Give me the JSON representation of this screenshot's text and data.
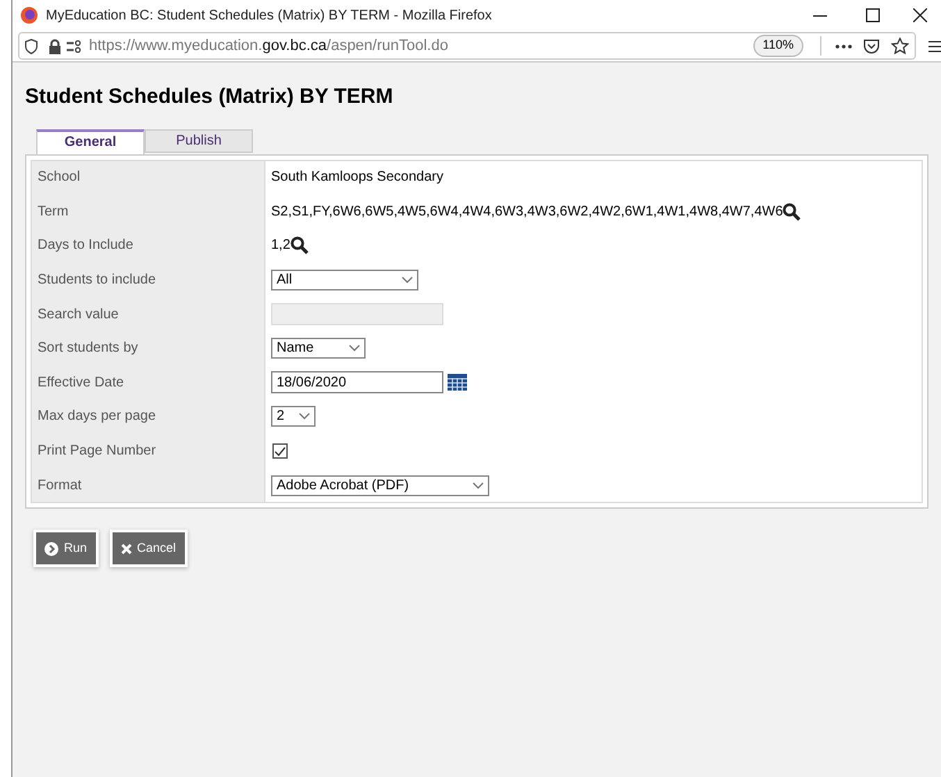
{
  "window": {
    "title": "MyEducation BC: Student Schedules (Matrix) BY TERM - Mozilla Firefox"
  },
  "toolbar": {
    "url_prefix": "https://www.myeducation.",
    "url_domain": "gov.bc.ca",
    "url_path": "/aspen/runTool.do",
    "zoom": "110%"
  },
  "heading": "Student Schedules (Matrix) BY TERM",
  "tabs": [
    {
      "label": "General",
      "selected": true
    },
    {
      "label": "Publish",
      "selected": false
    }
  ],
  "fields": [
    {
      "label": "School",
      "kind": "text",
      "value": "South Kamloops Secondary"
    },
    {
      "label": "Term",
      "kind": "lookup",
      "value": "S2,S1,FY,6W6,6W5,4W5,6W4,4W4,6W3,4W3,6W2,4W2,6W1,4W1,4W8,4W7,4W6"
    },
    {
      "label": "Days to Include",
      "kind": "lookup",
      "value": "1,2"
    },
    {
      "label": "Students to include",
      "kind": "select",
      "value": "All"
    },
    {
      "label": "Search value",
      "kind": "input",
      "disabled": true
    },
    {
      "label": "Sort students by",
      "kind": "select",
      "value": "Name"
    },
    {
      "label": "Effective Date",
      "kind": "date",
      "value": "18/06/2020"
    },
    {
      "label": "Max days per page",
      "kind": "select",
      "value": "2"
    },
    {
      "label": "Print Page Number",
      "kind": "checkbox",
      "checked": true
    },
    {
      "label": "Format",
      "kind": "select",
      "value": "Adobe Acrobat (PDF)"
    }
  ],
  "buttons": [
    {
      "label": "Run",
      "kind": "run"
    },
    {
      "label": "Cancel",
      "kind": "cancel"
    }
  ]
}
